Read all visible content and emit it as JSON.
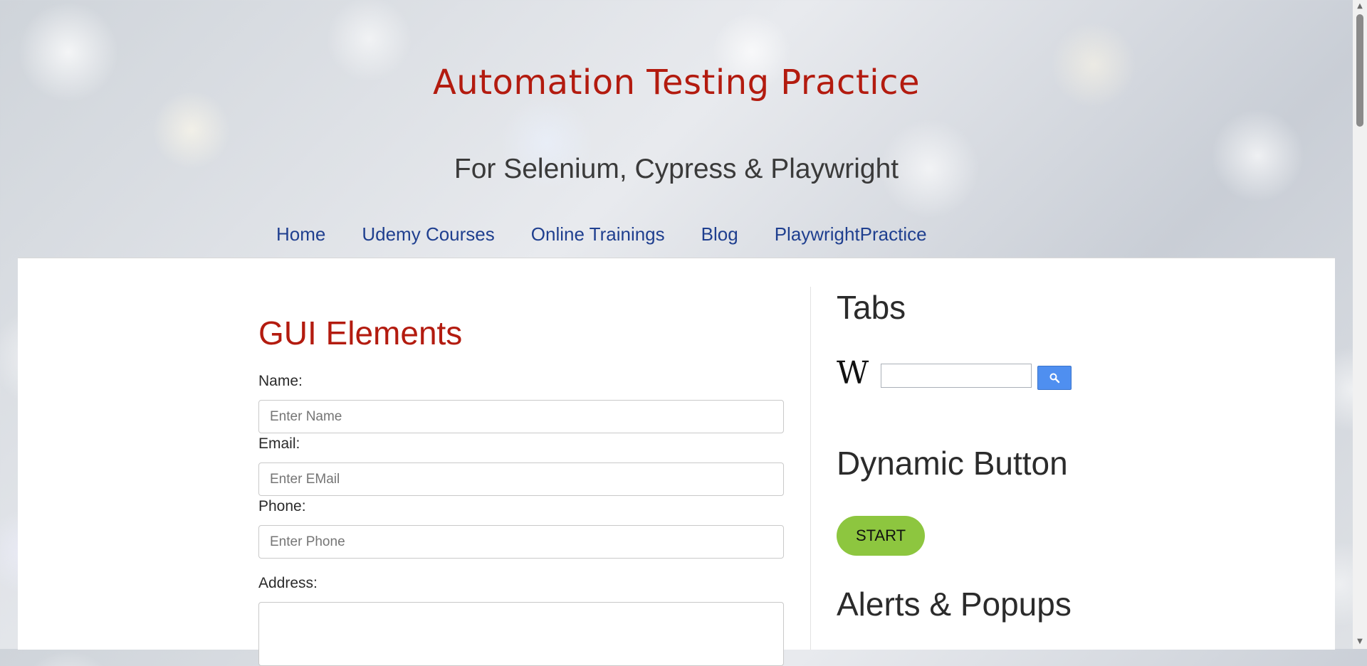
{
  "header": {
    "title": "Automation Testing Practice",
    "subtitle": "For Selenium, Cypress & Playwright"
  },
  "nav": {
    "items": [
      {
        "label": "Home"
      },
      {
        "label": "Udemy Courses"
      },
      {
        "label": "Online Trainings"
      },
      {
        "label": "Blog"
      },
      {
        "label": "PlaywrightPractice"
      }
    ]
  },
  "main": {
    "section_title": "GUI Elements",
    "fields": {
      "name": {
        "label": "Name:",
        "placeholder": "Enter Name",
        "value": ""
      },
      "email": {
        "label": "Email:",
        "placeholder": "Enter EMail",
        "value": ""
      },
      "phone": {
        "label": "Phone:",
        "placeholder": "Enter Phone",
        "value": ""
      },
      "address": {
        "label": "Address:",
        "value": ""
      }
    }
  },
  "sidebar": {
    "tabs_title": "Tabs",
    "wiki_logo": "W",
    "wiki_search_value": "",
    "wiki_search_icon": "search-icon",
    "dynamic_button_title": "Dynamic Button",
    "start_label": "START",
    "alerts_title": "Alerts & Popups"
  },
  "colors": {
    "title_red": "#b31b0f",
    "nav_blue": "#1f3f8f",
    "start_green": "#8dc63f",
    "wiki_button_blue": "#4f8ff0"
  }
}
